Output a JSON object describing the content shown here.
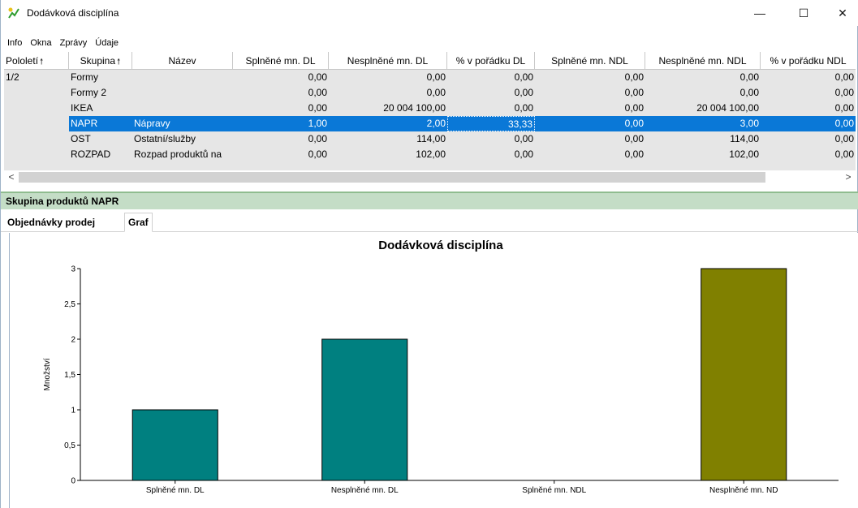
{
  "window": {
    "title": "Dodávková disciplína",
    "minimize_glyph": "—",
    "maximize_glyph": "☐",
    "close_glyph": "✕"
  },
  "menu": [
    "Info",
    "Okna",
    "Zprávy",
    "Údaje"
  ],
  "grid": {
    "columns": [
      "Pololetí",
      "Skupina",
      "Název",
      "Splněné mn. DL",
      "Nesplněné mn. DL",
      "% v pořádku DL",
      "Splněné mn. NDL",
      "Nesplněné mn. NDL",
      "% v pořádku NDL"
    ],
    "rows": [
      {
        "pololeti": "1/2",
        "skupina": "Formy",
        "nazev": "",
        "v1": "0,00",
        "v2": "0,00",
        "v3": "0,00",
        "v4": "0,00",
        "v5": "0,00",
        "v6": "0,00"
      },
      {
        "pololeti": "",
        "skupina": "Formy 2",
        "nazev": "",
        "v1": "0,00",
        "v2": "0,00",
        "v3": "0,00",
        "v4": "0,00",
        "v5": "0,00",
        "v6": "0,00"
      },
      {
        "pololeti": "",
        "skupina": "IKEA",
        "nazev": "",
        "v1": "0,00",
        "v2": "20 004 100,00",
        "v3": "0,00",
        "v4": "0,00",
        "v5": "20 004 100,00",
        "v6": "0,00"
      },
      {
        "pololeti": "",
        "skupina": "NAPR",
        "nazev": "Nápravy",
        "v1": "1,00",
        "v2": "2,00",
        "v3": "33,33",
        "v4": "0,00",
        "v5": "3,00",
        "v6": "0,00"
      },
      {
        "pololeti": "",
        "skupina": "OST",
        "nazev": "Ostatní/služby",
        "v1": "0,00",
        "v2": "114,00",
        "v3": "0,00",
        "v4": "0,00",
        "v5": "114,00",
        "v6": "0,00"
      },
      {
        "pololeti": "",
        "skupina": "ROZPAD",
        "nazev": "Rozpad produktů na",
        "v1": "0,00",
        "v2": "102,00",
        "v3": "0,00",
        "v4": "0,00",
        "v5": "102,00",
        "v6": "0,00"
      }
    ],
    "selected_index": 3
  },
  "group_bar": {
    "title": "Skupina produktů NAPR"
  },
  "tabs": [
    "Objednávky prodej",
    "Graf"
  ],
  "active_tab": "Graf",
  "chart_data": {
    "type": "bar",
    "title": "Dodávková disciplína",
    "ylabel": "Množství",
    "xlabel": "",
    "categories": [
      "Splněné mn. DL",
      "Nesplněné mn. DL",
      "Splněné mn. NDL",
      "Nesplněné mn. ND"
    ],
    "values": [
      1,
      2,
      0,
      3
    ],
    "colors": [
      "#008080",
      "#008080",
      "#008080",
      "#808000"
    ],
    "ylim": [
      0,
      3
    ],
    "yticks": [
      "0",
      "0,5",
      "1",
      "1,5",
      "2",
      "2,5",
      "3"
    ],
    "grid": false,
    "legend": "none"
  },
  "colors": {
    "selection": "#0a78d7",
    "group_bar": "#c4ddc6",
    "bar_teal": "#008080",
    "bar_olive": "#808000"
  }
}
